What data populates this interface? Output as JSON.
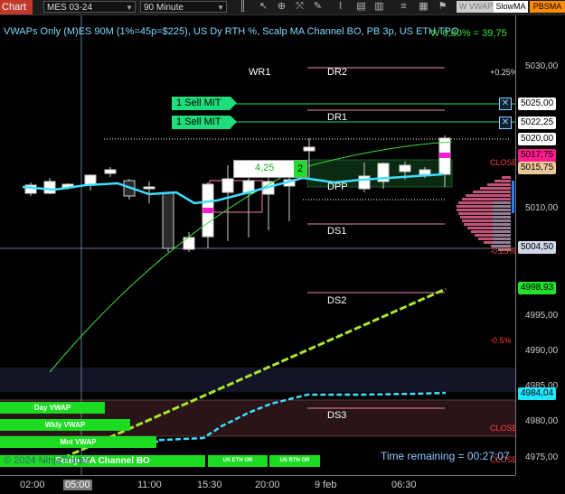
{
  "toolbar": {
    "chart_label": "Chart",
    "instrument": "MES 03-24",
    "interval": "90 Minute",
    "buttons": [
      {
        "name": "vwap-button",
        "label": "W VWAP",
        "bg": "#cccccc",
        "fg": "#777777"
      },
      {
        "name": "slowma-button",
        "label": "SlowMA",
        "bg": "#ffffff",
        "fg": "#000000"
      },
      {
        "name": "pbsma-button",
        "label": "PBSMA",
        "bg": "#ff8c00",
        "fg": "#000000"
      }
    ]
  },
  "chart": {
    "title": "VWAPs Only (M)ES 90M  (1%=45p=$225), US Dy RTH %, Scalp MA Channel BO, PB 3p, US ETH TPO",
    "w_text": "W 0,80% = 39,75",
    "time_remaining": "Time remaining = 00:27:07",
    "copyright": "© 2024 NinjaTrader"
  },
  "levels": [
    {
      "name": "WR1",
      "label": "WR1",
      "color": "#8f8fe0"
    },
    {
      "name": "DR2",
      "label": "DR2",
      "color": "#e88ea8"
    },
    {
      "name": "DR1",
      "label": "DR1",
      "color": "#e88ea8"
    },
    {
      "name": "DPP",
      "label": "DPP",
      "color": "#ffffff"
    },
    {
      "name": "DS1",
      "label": "DS1",
      "color": "#e88ea8"
    },
    {
      "name": "DS2",
      "label": "DS2",
      "color": "#e88ea8"
    },
    {
      "name": "DS3",
      "label": "DS3",
      "color": "#e88ea8"
    }
  ],
  "percent_labels": {
    "plus_025": "+0.25%",
    "minus_025": "-0.25%",
    "minus_05": "-0.5%",
    "close1": "CLOSE",
    "close2": "CLOSE",
    "close3": "CLOSE"
  },
  "orders": [
    {
      "label": "1  Sell MIT",
      "price": "5025,00"
    },
    {
      "label": "1  Sell MIT",
      "price": "5022,25"
    }
  ],
  "order_entry": {
    "value": "4,25",
    "qty": "2"
  },
  "price_axis": {
    "ticks": [
      "5030,00",
      "5010,00",
      "4995,00",
      "4990,00",
      "4985,00",
      "4980,00",
      "4975,00"
    ],
    "tags": [
      {
        "name": "price-tag-5020",
        "label": "5020,00",
        "bg": "#ffffff",
        "fg": "#000000"
      },
      {
        "name": "price-tag-5017",
        "label": "5017,75",
        "bg": "#ff1c8c",
        "fg": "#000000"
      },
      {
        "name": "price-tag-5015",
        "label": "5015,75",
        "bg": "#e8c79a",
        "fg": "#000000"
      },
      {
        "name": "price-tag-5004",
        "label": "5004,50",
        "bg": "#cfd6e6",
        "fg": "#000000"
      },
      {
        "name": "price-tag-4998",
        "label": "4998,93",
        "bg": "#22e12a",
        "fg": "#000000"
      },
      {
        "name": "price-tag-4984",
        "label": "4984,04",
        "bg": "#22e6ff",
        "fg": "#000000"
      }
    ]
  },
  "time_axis": {
    "labels": [
      "02:00",
      "05:00",
      "11:00",
      "15:30",
      "20:00",
      "9 feb",
      "06:30"
    ]
  },
  "indicators": [
    {
      "name": "day-vwap-button",
      "label": "Day VWAP"
    },
    {
      "name": "wkly-vwap-button",
      "label": "Wkly VWAP"
    },
    {
      "name": "mnt-vwap-button",
      "label": "Mnt VWAP"
    },
    {
      "name": "scalp-ma-channel-label",
      "label": "Scalp MA Channel BO"
    },
    {
      "name": "us-eth-or-button",
      "label": "US ETH OR"
    },
    {
      "name": "us-rth-or-button",
      "label": "US RTH OR"
    }
  ],
  "colors": {
    "vwap_day": "#3ee0ff",
    "vwap_week": "#a7e82d",
    "vwap_month": "#3ee0ff",
    "sma": "#3ee03e",
    "order_line": "#1fdd7a",
    "profile": "#ff6fa0"
  }
}
